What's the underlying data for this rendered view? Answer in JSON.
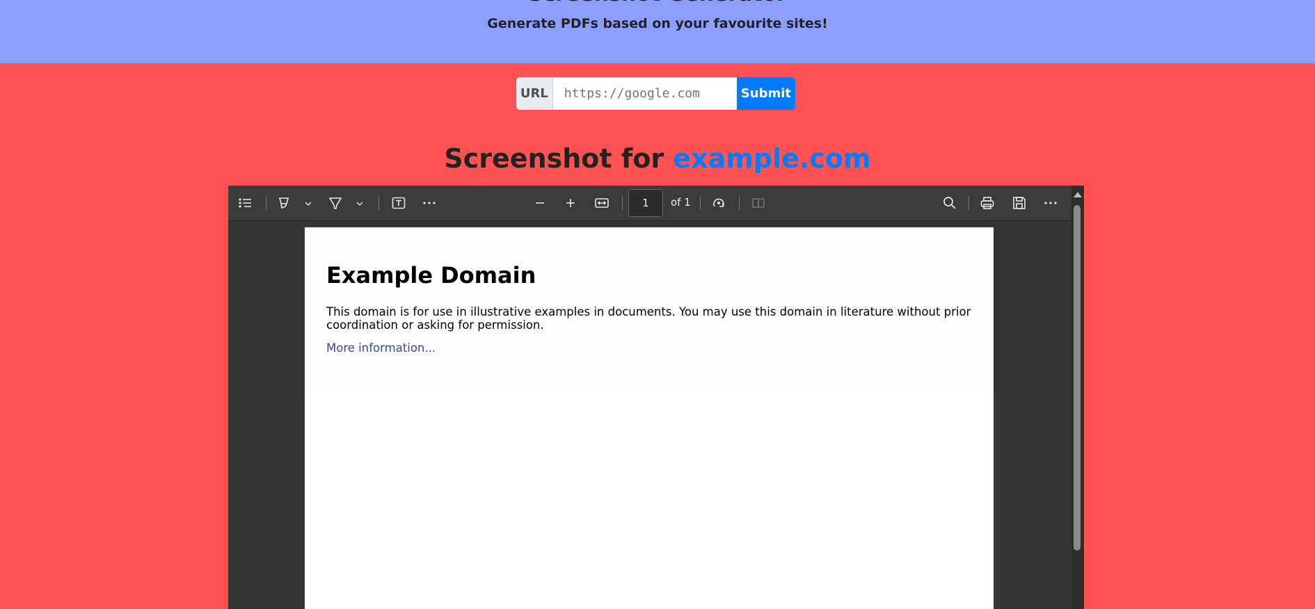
{
  "banner": {
    "title_cut": "Screenshot Generator",
    "subtitle": "Generate PDFs based on your favourite sites!"
  },
  "form": {
    "url_label": "URL",
    "url_placeholder": "https://google.com",
    "submit_label": "Submit"
  },
  "heading": {
    "prefix": "Screenshot for ",
    "site": "example.com"
  },
  "viewer": {
    "page_number": "1",
    "page_total": "of 1",
    "icons": [
      "contents-icon",
      "highlight-icon",
      "draw-icon",
      "text-icon",
      "more-tools-icon",
      "zoom-out-icon",
      "zoom-in-icon",
      "fit-width-icon",
      "rotate-icon",
      "two-page-icon",
      "search-icon",
      "print-icon",
      "save-icon",
      "more-options-icon"
    ]
  },
  "document": {
    "title": "Example Domain",
    "body": "This domain is for use in illustrative examples in documents. You may use this domain in literature without prior coordination or asking for permission.",
    "link": "More information..."
  },
  "colors": {
    "background": "#ff5252",
    "banner": "#8c9eff",
    "primary": "#007bff",
    "viewer": "#353535"
  }
}
